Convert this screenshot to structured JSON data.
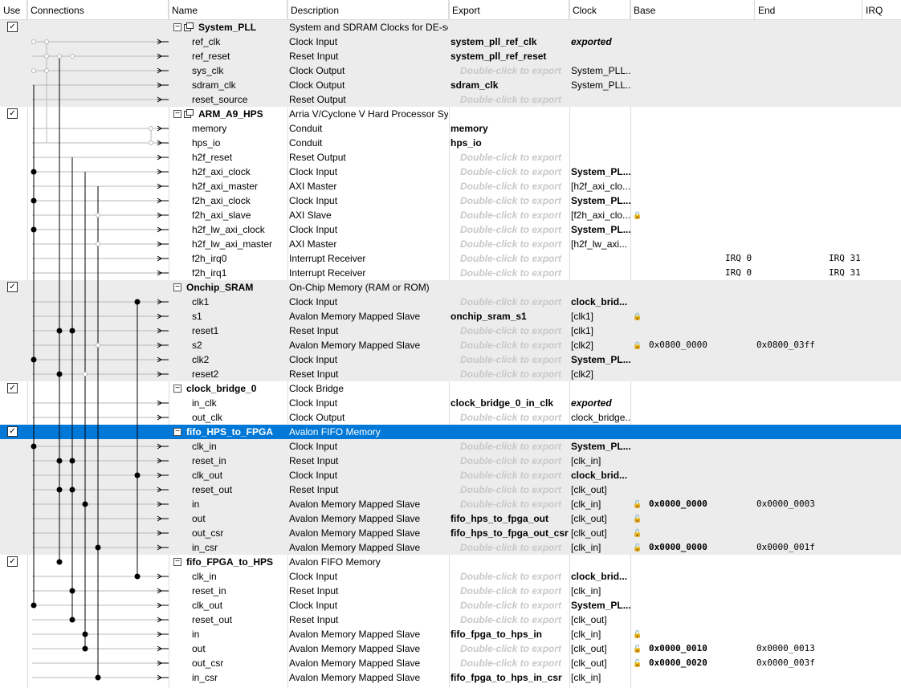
{
  "columns": [
    "Use",
    "Connections",
    "Name",
    "Description",
    "Export",
    "Clock",
    "Base",
    "End",
    "IRQ"
  ],
  "rows": [
    {
      "kind": "comp",
      "gray": true,
      "icon": true,
      "checked": true,
      "name": "System_PLL",
      "desc": "System and SDRAM Clocks for DE-seri...",
      "export": "",
      "clock": ""
    },
    {
      "kind": "port",
      "gray": true,
      "name": "ref_clk",
      "desc": "Clock Input",
      "export": "system_pll_ref_clk",
      "exp_style": "b",
      "clock": "exported",
      "clk_style": "ex"
    },
    {
      "kind": "port",
      "gray": true,
      "name": "ref_reset",
      "desc": "Reset Input",
      "export": "system_pll_ref_reset",
      "exp_style": "b",
      "clock": ""
    },
    {
      "kind": "port",
      "gray": true,
      "name": "sys_clk",
      "desc": "Clock Output",
      "export": "Double-click to export",
      "exp_style": "ph",
      "clock": "System_PLL..."
    },
    {
      "kind": "port",
      "gray": true,
      "name": "sdram_clk",
      "desc": "Clock Output",
      "export": "sdram_clk",
      "exp_style": "b",
      "clock": "System_PLL..."
    },
    {
      "kind": "port",
      "gray": true,
      "name": "reset_source",
      "desc": "Reset Output",
      "export": "Double-click to export",
      "exp_style": "ph",
      "clock": ""
    },
    {
      "kind": "comp",
      "gray": false,
      "icon": true,
      "checked": true,
      "name": "ARM_A9_HPS",
      "desc": "Arria V/Cyclone V Hard Processor System",
      "export": "",
      "clock": ""
    },
    {
      "kind": "port",
      "gray": false,
      "name": "memory",
      "desc": "Conduit",
      "export": "memory",
      "exp_style": "b",
      "clock": ""
    },
    {
      "kind": "port",
      "gray": false,
      "name": "hps_io",
      "desc": "Conduit",
      "export": "hps_io",
      "exp_style": "b",
      "clock": ""
    },
    {
      "kind": "port",
      "gray": false,
      "name": "h2f_reset",
      "desc": "Reset Output",
      "export": "Double-click to export",
      "exp_style": "ph",
      "clock": ""
    },
    {
      "kind": "port",
      "gray": false,
      "name": "h2f_axi_clock",
      "desc": "Clock Input",
      "export": "Double-click to export",
      "exp_style": "ph",
      "clock": "System_PL...",
      "clk_style": "b"
    },
    {
      "kind": "port",
      "gray": false,
      "name": "h2f_axi_master",
      "desc": "AXI Master",
      "export": "Double-click to export",
      "exp_style": "ph",
      "clock": "[h2f_axi_clo..."
    },
    {
      "kind": "port",
      "gray": false,
      "name": "f2h_axi_clock",
      "desc": "Clock Input",
      "export": "Double-click to export",
      "exp_style": "ph",
      "clock": "System_PL...",
      "clk_style": "b"
    },
    {
      "kind": "port",
      "gray": false,
      "name": "f2h_axi_slave",
      "desc": "AXI Slave",
      "export": "Double-click to export",
      "exp_style": "ph",
      "clock": "[f2h_axi_clo...",
      "lock": "closed"
    },
    {
      "kind": "port",
      "gray": false,
      "name": "h2f_lw_axi_clock",
      "desc": "Clock Input",
      "export": "Double-click to export",
      "exp_style": "ph",
      "clock": "System_PL...",
      "clk_style": "b"
    },
    {
      "kind": "port",
      "gray": false,
      "name": "h2f_lw_axi_master",
      "desc": "AXI Master",
      "export": "Double-click to export",
      "exp_style": "ph",
      "clock": "[h2f_lw_axi..."
    },
    {
      "kind": "port",
      "gray": false,
      "name": "f2h_irq0",
      "desc": "Interrupt Receiver",
      "export": "Double-click to export",
      "exp_style": "ph",
      "clock": "",
      "irq_lo": "IRQ 0",
      "irq_hi": "IRQ 31"
    },
    {
      "kind": "port",
      "gray": false,
      "name": "f2h_irq1",
      "desc": "Interrupt Receiver",
      "export": "Double-click to export",
      "exp_style": "ph",
      "clock": "",
      "irq_lo": "IRQ 0",
      "irq_hi": "IRQ 31"
    },
    {
      "kind": "comp",
      "gray": true,
      "icon": false,
      "checked": true,
      "name": "Onchip_SRAM",
      "desc": "On-Chip Memory (RAM or ROM)",
      "export": "",
      "clock": ""
    },
    {
      "kind": "port",
      "gray": true,
      "name": "clk1",
      "desc": "Clock Input",
      "export": "Double-click to export",
      "exp_style": "ph",
      "clock": "clock_brid...",
      "clk_style": "b"
    },
    {
      "kind": "port",
      "gray": true,
      "name": "s1",
      "desc": "Avalon Memory Mapped Slave",
      "export": "onchip_sram_s1",
      "exp_style": "b",
      "clock": "[clk1]",
      "lock": "closed"
    },
    {
      "kind": "port",
      "gray": true,
      "name": "reset1",
      "desc": "Reset Input",
      "export": "Double-click to export",
      "exp_style": "ph",
      "clock": "[clk1]"
    },
    {
      "kind": "port",
      "gray": true,
      "name": "s2",
      "desc": "Avalon Memory Mapped Slave",
      "export": "Double-click to export",
      "exp_style": "ph",
      "clock": "[clk2]",
      "lock": "closed",
      "base": "0x0800_0000",
      "end": "0x0800_03ff",
      "base_bold": false
    },
    {
      "kind": "port",
      "gray": true,
      "name": "clk2",
      "desc": "Clock Input",
      "export": "Double-click to export",
      "exp_style": "ph",
      "clock": "System_PL...",
      "clk_style": "b"
    },
    {
      "kind": "port",
      "gray": true,
      "name": "reset2",
      "desc": "Reset Input",
      "export": "Double-click to export",
      "exp_style": "ph",
      "clock": "[clk2]"
    },
    {
      "kind": "comp",
      "gray": false,
      "icon": false,
      "checked": true,
      "name": "clock_bridge_0",
      "desc": "Clock Bridge",
      "export": "",
      "clock": ""
    },
    {
      "kind": "port",
      "gray": false,
      "name": "in_clk",
      "desc": "Clock Input",
      "export": "clock_bridge_0_in_clk",
      "exp_style": "b",
      "clock": "exported",
      "clk_style": "ex"
    },
    {
      "kind": "port",
      "gray": false,
      "name": "out_clk",
      "desc": "Clock Output",
      "export": "Double-click to export",
      "exp_style": "ph",
      "clock": "clock_bridge..."
    },
    {
      "kind": "comp",
      "gray": false,
      "sel": true,
      "icon": false,
      "checked": true,
      "name": "fifo_HPS_to_FPGA",
      "desc": "Avalon FIFO Memory",
      "export": "",
      "clock": ""
    },
    {
      "kind": "port",
      "gray": true,
      "name": "clk_in",
      "desc": "Clock Input",
      "export": "Double-click to export",
      "exp_style": "ph",
      "clock": "System_PL...",
      "clk_style": "b"
    },
    {
      "kind": "port",
      "gray": true,
      "name": "reset_in",
      "desc": "Reset Input",
      "export": "Double-click to export",
      "exp_style": "ph",
      "clock": "[clk_in]"
    },
    {
      "kind": "port",
      "gray": true,
      "name": "clk_out",
      "desc": "Clock Input",
      "export": "Double-click to export",
      "exp_style": "ph",
      "clock": "clock_brid...",
      "clk_style": "b"
    },
    {
      "kind": "port",
      "gray": true,
      "name": "reset_out",
      "desc": "Reset Input",
      "export": "Double-click to export",
      "exp_style": "ph",
      "clock": "[clk_out]"
    },
    {
      "kind": "port",
      "gray": true,
      "name": "in",
      "desc": "Avalon Memory Mapped Slave",
      "export": "Double-click to export",
      "exp_style": "ph",
      "clock": "[clk_in]",
      "lock": "open",
      "base": "0x0000_0000",
      "end": "0x0000_0003",
      "base_bold": true
    },
    {
      "kind": "port",
      "gray": true,
      "name": "out",
      "desc": "Avalon Memory Mapped Slave",
      "export": "fifo_hps_to_fpga_out",
      "exp_style": "b",
      "clock": "[clk_out]",
      "lock": "open"
    },
    {
      "kind": "port",
      "gray": true,
      "name": "out_csr",
      "desc": "Avalon Memory Mapped Slave",
      "export": "fifo_hps_to_fpga_out_csr",
      "exp_style": "b",
      "clock": "[clk_out]",
      "lock": "open"
    },
    {
      "kind": "port",
      "gray": true,
      "name": "in_csr",
      "desc": "Avalon Memory Mapped Slave",
      "export": "Double-click to export",
      "exp_style": "ph",
      "clock": "[clk_in]",
      "lock": "open",
      "base": "0x0000_0000",
      "end": "0x0000_001f",
      "base_bold": true
    },
    {
      "kind": "comp",
      "gray": false,
      "icon": false,
      "checked": true,
      "name": "fifo_FPGA_to_HPS",
      "desc": "Avalon FIFO Memory",
      "export": "",
      "clock": ""
    },
    {
      "kind": "port",
      "gray": false,
      "name": "clk_in",
      "desc": "Clock Input",
      "export": "Double-click to export",
      "exp_style": "ph",
      "clock": "clock_brid...",
      "clk_style": "b"
    },
    {
      "kind": "port",
      "gray": false,
      "name": "reset_in",
      "desc": "Reset Input",
      "export": "Double-click to export",
      "exp_style": "ph",
      "clock": "[clk_in]"
    },
    {
      "kind": "port",
      "gray": false,
      "name": "clk_out",
      "desc": "Clock Input",
      "export": "Double-click to export",
      "exp_style": "ph",
      "clock": "System_PL...",
      "clk_style": "b"
    },
    {
      "kind": "port",
      "gray": false,
      "name": "reset_out",
      "desc": "Reset Input",
      "export": "Double-click to export",
      "exp_style": "ph",
      "clock": "[clk_out]"
    },
    {
      "kind": "port",
      "gray": false,
      "name": "in",
      "desc": "Avalon Memory Mapped Slave",
      "export": "fifo_fpga_to_hps_in",
      "exp_style": "b",
      "clock": "[clk_in]",
      "lock": "open"
    },
    {
      "kind": "port",
      "gray": false,
      "name": "out",
      "desc": "Avalon Memory Mapped Slave",
      "export": "Double-click to export",
      "exp_style": "ph",
      "clock": "[clk_out]",
      "lock": "open",
      "base": "0x0000_0010",
      "end": "0x0000_0013",
      "base_bold": true
    },
    {
      "kind": "port",
      "gray": false,
      "name": "out_csr",
      "desc": "Avalon Memory Mapped Slave",
      "export": "Double-click to export",
      "exp_style": "ph",
      "clock": "[clk_out]",
      "lock": "open",
      "base": "0x0000_0020",
      "end": "0x0000_003f",
      "base_bold": true
    },
    {
      "kind": "port",
      "gray": false,
      "name": "in_csr",
      "desc": "Avalon Memory Mapped Slave",
      "export": "fifo_fpga_to_hps_in_csr",
      "exp_style": "b",
      "clock": "[clk_in]"
    }
  ],
  "glyphs": {
    "checkmark": "✓",
    "toggle": "−",
    "lock_closed": "🔒",
    "lock_open": "🔓"
  },
  "colors": {
    "selection": "#0078d7",
    "group_band": "#ececec",
    "placeholder_text": "#c8c8c8",
    "wire": "#000000",
    "wire_dim": "#b8b8b8"
  }
}
